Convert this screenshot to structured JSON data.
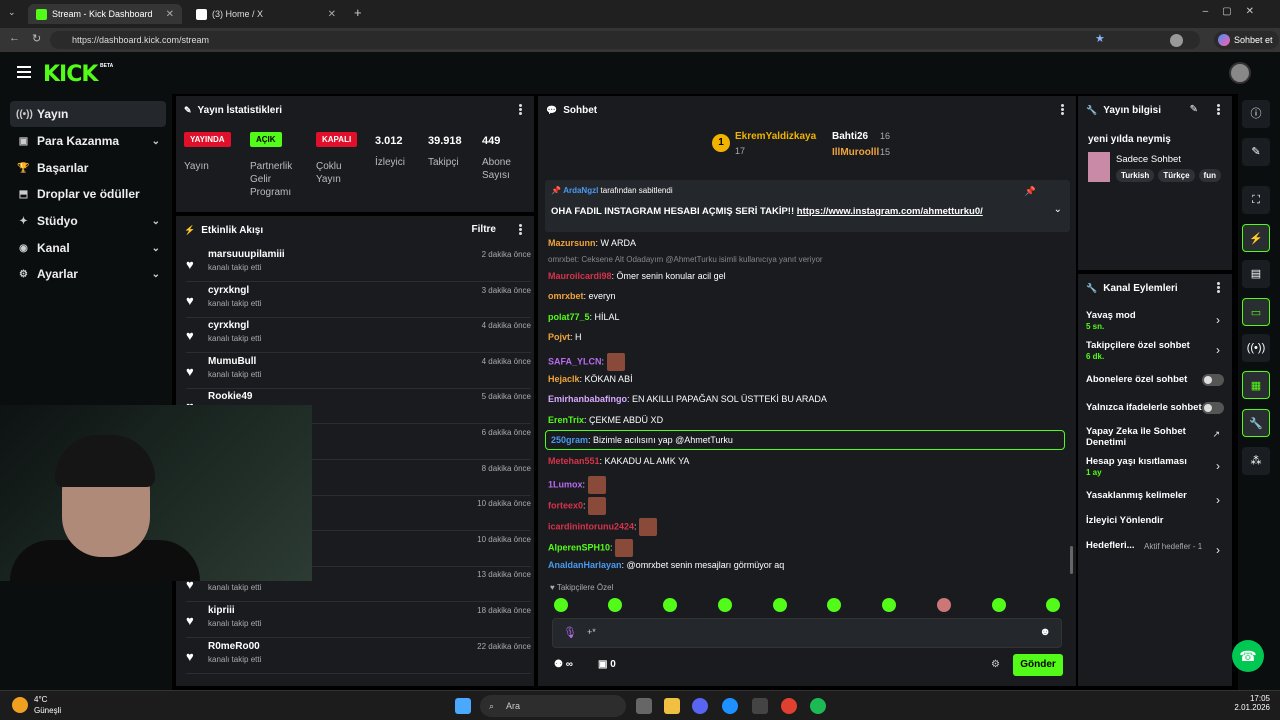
{
  "browser": {
    "tabs": [
      {
        "title": "Stream - Kick Dashboard",
        "close": "✕"
      },
      {
        "title": "(3) Home / X",
        "close": "✕"
      }
    ],
    "new_tab": "+",
    "url": "https://dashboard.kick.com/stream",
    "copilot": "Sohbet et"
  },
  "kick": {
    "logo": "KICK",
    "beta": "BETA"
  },
  "sidenav": [
    {
      "label": "Yayın",
      "icon": "((•))",
      "chevron": ""
    },
    {
      "label": "Para Kazanma",
      "icon": "▣",
      "chevron": "⌄"
    },
    {
      "label": "Başarılar",
      "icon": "🏆",
      "chevron": ""
    },
    {
      "label": "Droplar ve ödüller",
      "icon": "⬒",
      "chevron": ""
    },
    {
      "label": "Stüdyo",
      "icon": "✦",
      "chevron": "⌄"
    },
    {
      "label": "Kanal",
      "icon": "◉",
      "chevron": "⌄"
    },
    {
      "label": "Ayarlar",
      "icon": "⚙",
      "chevron": "⌄"
    }
  ],
  "stats": {
    "title": "Yayın İstatistikleri",
    "items": [
      {
        "badge": "YAYINDA",
        "label": "Yayın"
      },
      {
        "badge": "AÇIK",
        "label": "Partnerlik Gelir Programı"
      },
      {
        "badge": "KAPALI",
        "label": "Çoklu Yayın"
      },
      {
        "value": "3.012",
        "label": "İzleyici"
      },
      {
        "value": "39.918",
        "label": "Takipçi"
      },
      {
        "value": "449",
        "label": "Abone Sayısı"
      }
    ]
  },
  "activity": {
    "title": "Etkinlik Akışı",
    "filter": "Filtre",
    "items": [
      {
        "name": "marsuuupilamiii",
        "sub": "kanalı takip etti",
        "time": "2 dakika önce"
      },
      {
        "name": "cyrxkngl",
        "sub": "kanalı takip etti",
        "time": "3 dakika önce"
      },
      {
        "name": "cyrxkngl",
        "sub": "kanalı takip etti",
        "time": "4 dakika önce"
      },
      {
        "name": "MumuBull",
        "sub": "kanalı takip etti",
        "time": "4 dakika önce"
      },
      {
        "name": "Rookie49",
        "sub": "kanalı takip etti",
        "time": "5 dakika önce"
      },
      {
        "name": "",
        "sub": "",
        "time": "6 dakika önce"
      },
      {
        "name": "",
        "sub": "",
        "time": "8 dakika önce"
      },
      {
        "name": "",
        "sub": "",
        "time": "10 dakika önce"
      },
      {
        "name": "",
        "sub": "",
        "time": "10 dakika önce"
      },
      {
        "name": "",
        "sub": "kanalı takip etti",
        "time": "13 dakika önce"
      },
      {
        "name": "kipriii",
        "sub": "kanalı takip etti",
        "time": "18 dakika önce"
      },
      {
        "name": "R0meRo00",
        "sub": "kanalı takip etti",
        "time": "22 dakika önce"
      }
    ]
  },
  "chat": {
    "title": "Sohbet",
    "leaders": [
      {
        "name": "EkremYaldizkaya",
        "count": "17",
        "rank": "1"
      },
      {
        "name": "Bahti26",
        "count": "16"
      },
      {
        "name": "IllMuroolll",
        "count": "15"
      }
    ],
    "pinned": {
      "by": "ArdaNgzl",
      "by_suffix": "tarafından sabitlendi",
      "text": "OHA FADIL INSTAGRAM HESABI AÇMIŞ SERİ TAKİP!!",
      "link": "https://www.instagram.com/ahmetturku0/"
    },
    "messages": [
      {
        "user": "Mazursunn",
        "text": "W ARDA",
        "color": "#f0a43a"
      },
      {
        "reply": "omrxbet: Ceksene Alt Odadayım @AhmetTurku isimli kullanıcıya yanıt veriyor",
        "user": "Mauroilcardi98",
        "text": "Ömer senin konular acil gel",
        "color": "#d6334a"
      },
      {
        "user": "omrxbet",
        "text": "everyn",
        "color": "#f0a43a"
      },
      {
        "user": "polat77_5",
        "text": "HİLAL",
        "color": "#53fc18"
      },
      {
        "user": "Pojvt",
        "text": "H",
        "color": "#f0a43a"
      },
      {
        "user": "SAFA_YLCN",
        "text": "",
        "color": "#b86bf0",
        "emote": true
      },
      {
        "user": "Hejaclk",
        "text": "KÖKAN ABİ",
        "color": "#f0a43a"
      },
      {
        "user": "Emirhanbabafingo",
        "text": "EN AKILLI PAPAĞAN SOL ÜSTTEKİ BU ARADA",
        "color": "#d9a8ff"
      },
      {
        "user": "ErenTrix",
        "text": "ÇEKME ABDÜ XD",
        "color": "#53fc18"
      },
      {
        "user": "250gram",
        "text": "Bizimle acılısını yap @AhmetTurku",
        "color": "#4a9af0",
        "highlight": true
      },
      {
        "user": "Metehan551",
        "text": "KAKADU AL AMK YA",
        "color": "#d6334a"
      },
      {
        "user": "1Lumox",
        "text": "",
        "color": "#b86bf0",
        "emote": true
      },
      {
        "user": "forteex0",
        "text": "",
        "color": "#d6334a",
        "emote": true
      },
      {
        "user": "icardinintorunu2424",
        "text": "",
        "color": "#d6334a",
        "emote": true
      },
      {
        "user": "AlperenSPH10",
        "text": "",
        "color": "#53fc18",
        "emote": true
      },
      {
        "user": "AnaldanHarlayan",
        "text": "@omrxbet senin mesajları görmüyor aq",
        "color": "#4a9af0"
      }
    ],
    "followers_only": "Takipçilere Özel",
    "input_placeholder": "",
    "send": "Gönder",
    "points": "0",
    "infinity": "∞"
  },
  "stream_info": {
    "title": "Yayın bilgisi",
    "stream_title": "yeni yılda neymiş",
    "category": "Sadece Sohbet",
    "tags": [
      "Turkish",
      "Türkçe",
      "fun"
    ]
  },
  "channel_actions": {
    "title": "Kanal Eylemleri",
    "items": [
      {
        "label": "Yavaş mod",
        "sub": "5 sn.",
        "type": "arrow"
      },
      {
        "label": "Takipçilere özel sohbet",
        "sub": "6 dk.",
        "type": "arrow"
      },
      {
        "label": "Abonelere özel sohbet",
        "sub": "",
        "type": "toggle"
      },
      {
        "label": "Yalnızca ifadelerle sohbet",
        "sub": "",
        "type": "toggle"
      },
      {
        "label": "Yapay Zeka ile Sohbet Denetimi",
        "sub": "",
        "type": "external"
      },
      {
        "label": "Hesap yaşı kısıtlaması",
        "sub": "1 ay",
        "type": "arrow"
      },
      {
        "label": "Yasaklanmış kelimeler",
        "sub": "",
        "type": "arrow"
      },
      {
        "label": "İzleyici Yönlendir",
        "sub": "",
        "type": "none"
      },
      {
        "label": "Hedefleri...",
        "sub": "Aktif hedefler - 1",
        "type": "arrow"
      }
    ]
  },
  "taskbar": {
    "weather_temp": "4°C",
    "weather_desc": "Güneşli",
    "search": "Ara",
    "time": "17:05",
    "date": "2.01.2026"
  }
}
